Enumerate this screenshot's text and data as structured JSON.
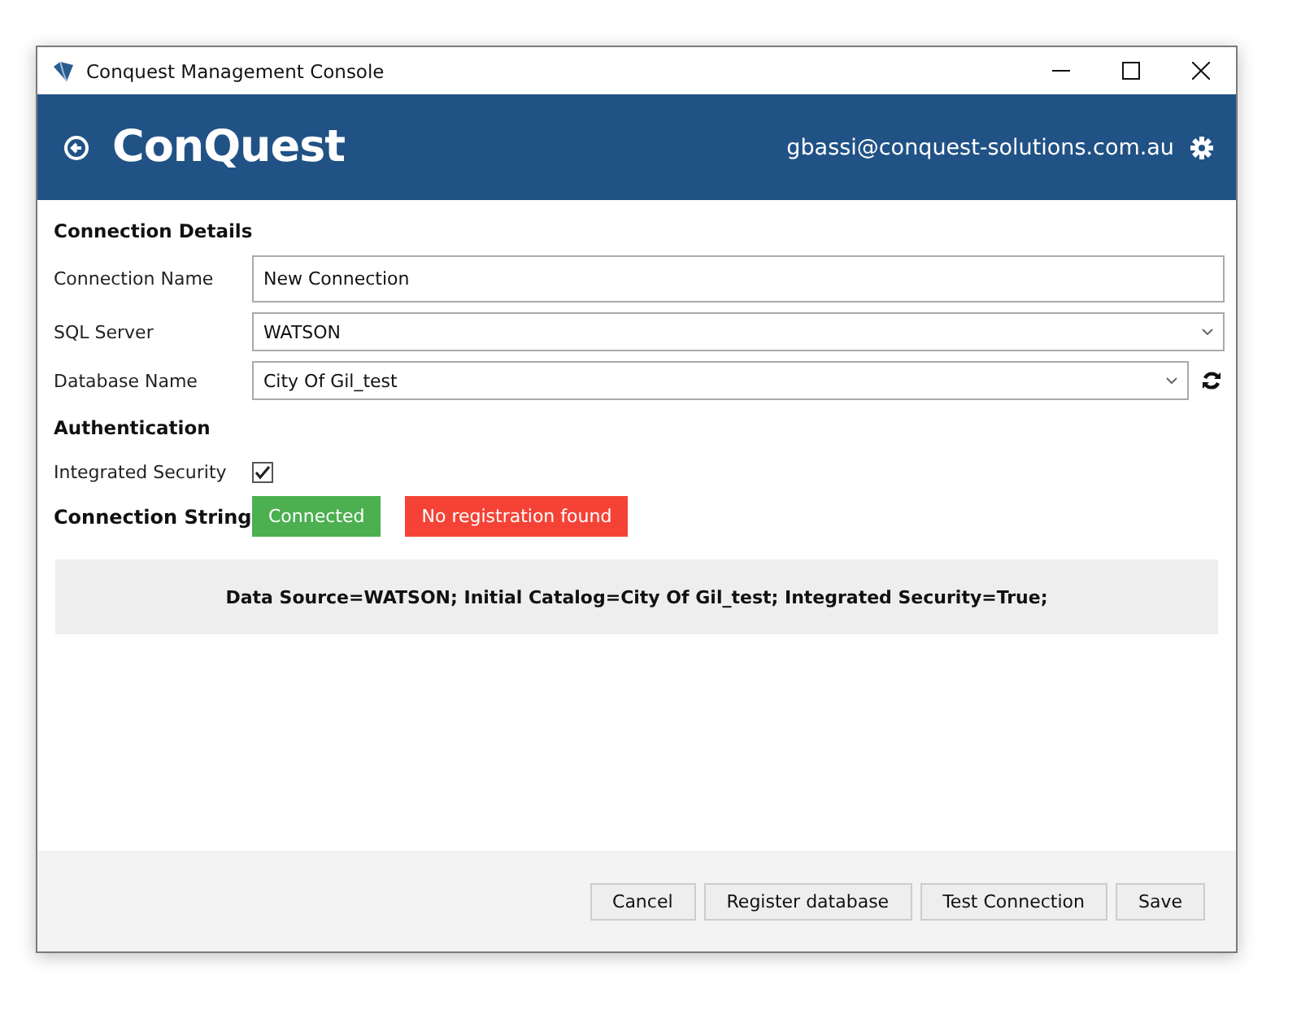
{
  "window": {
    "title": "Conquest Management Console"
  },
  "header": {
    "logo": "ConQuest",
    "user": "gbassi@conquest-solutions.com.au"
  },
  "connection_details": {
    "heading": "Connection Details",
    "fields": [
      {
        "label": "Connection Name",
        "kind": "text",
        "value": "New Connection"
      },
      {
        "label": "SQL Server",
        "kind": "dropdown",
        "value": "WATSON"
      },
      {
        "label": "Database Name",
        "kind": "dropdown-refresh",
        "value": "City Of Gil_test"
      }
    ]
  },
  "authentication": {
    "heading": "Authentication",
    "label": "Integrated Security",
    "checked": true
  },
  "connection_string": {
    "heading": "Connection String",
    "badges": [
      {
        "text": "Connected",
        "kind": "success"
      },
      {
        "text": "No registration found",
        "kind": "error"
      }
    ],
    "value": "Data Source=WATSON; Initial Catalog=City Of Gil_test; Integrated Security=True;"
  },
  "buttons": [
    "Cancel",
    "Register database",
    "Test Connection",
    "Save"
  ]
}
